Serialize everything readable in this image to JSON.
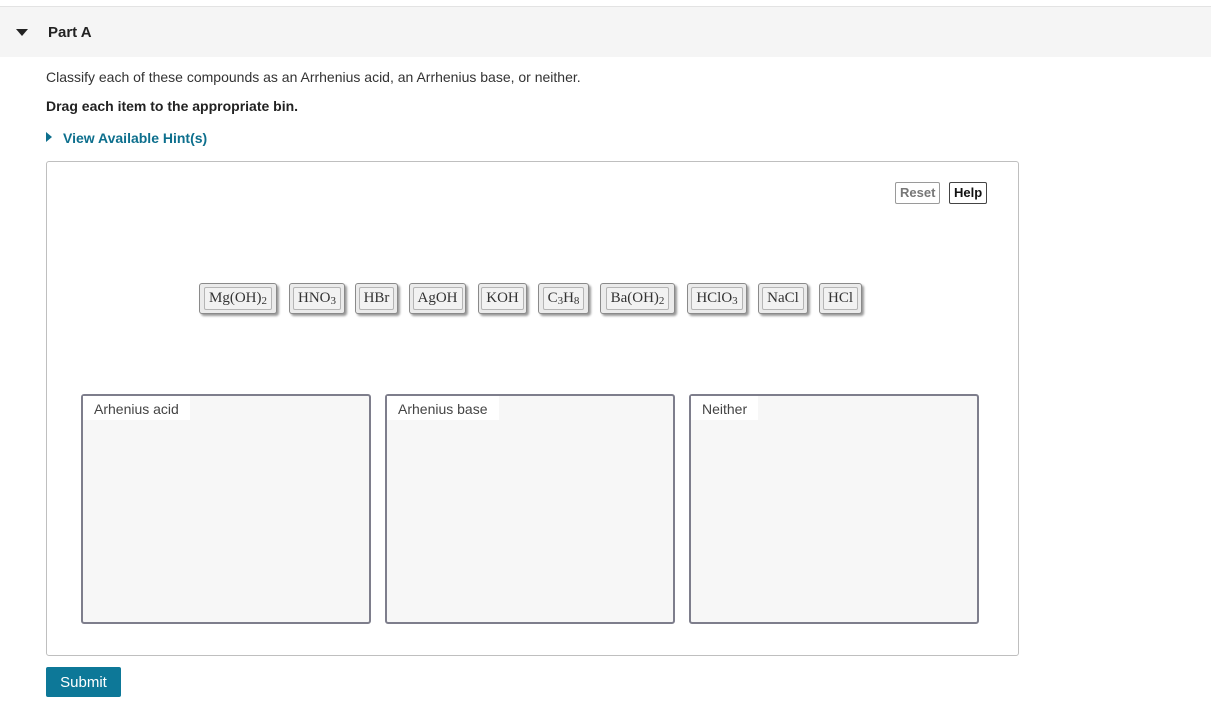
{
  "part": {
    "title": "Part A"
  },
  "question": {
    "instructions": "Classify each of these compounds as an Arrhenius acid, an Arrhenius base, or neither.",
    "drag_note": "Drag each item to the appropriate bin.",
    "hint_label": "View Available Hint(s)"
  },
  "controls": {
    "reset_label": "Reset",
    "help_label": "Help",
    "submit_label": "Submit"
  },
  "compounds": [
    {
      "base": "Mg(OH)",
      "sub": "2"
    },
    {
      "base": "HNO",
      "sub": "3"
    },
    {
      "base": "HBr",
      "sub": ""
    },
    {
      "base": "AgOH",
      "sub": ""
    },
    {
      "base": "KOH",
      "sub": ""
    },
    {
      "base": "C",
      "sub": "3",
      "base2": "H",
      "sub2": "8"
    },
    {
      "base": "Ba(OH)",
      "sub": "2"
    },
    {
      "base": "HClO",
      "sub": "3"
    },
    {
      "base": "NaCl",
      "sub": ""
    },
    {
      "base": "HCl",
      "sub": ""
    }
  ],
  "bins": [
    {
      "label": "Arhenius acid"
    },
    {
      "label": "Arhenius base"
    },
    {
      "label": "Neither"
    }
  ],
  "colors": {
    "accent": "#0d7898",
    "link": "#0d6f8d",
    "header_bg": "#f5f5f5"
  }
}
